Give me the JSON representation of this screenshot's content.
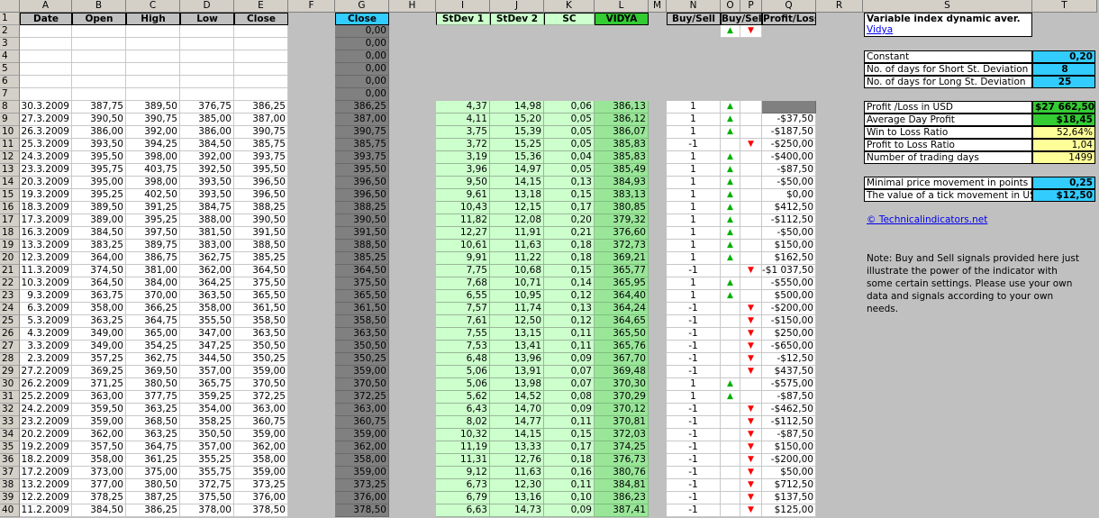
{
  "columns": [
    "A",
    "B",
    "C",
    "D",
    "E",
    "F",
    "G",
    "H",
    "I",
    "J",
    "K",
    "L",
    "M",
    "N",
    "O",
    "P",
    "Q",
    "R",
    "S",
    "T"
  ],
  "headers": {
    "date": "Date",
    "open": "Open",
    "high": "High",
    "low": "Low",
    "close": "Close",
    "close2": "Close",
    "stdev1": "StDev 1",
    "stdev2": "StDev 2",
    "sc": "SC",
    "vidya": "VIDYA",
    "buysell_n": "Buy/Sell",
    "buysell_op": "Buy/Sell",
    "pl": "Profit/Loss",
    "buy_arrow": "▲",
    "sell_arrow": "▼"
  },
  "zero_rows": [
    "0,00",
    "0,00",
    "0,00",
    "0,00",
    "0,00",
    "0,00"
  ],
  "rows": [
    {
      "date": "30.3.2009",
      "open": "387,75",
      "high": "389,50",
      "low": "376,75",
      "close": "386,25",
      "g": "386,25",
      "s1": "4,37",
      "s2": "14,98",
      "sc": "0,06",
      "vidya": "386,13",
      "bs": "1",
      "sig": "up",
      "pl": ""
    },
    {
      "date": "27.3.2009",
      "open": "390,50",
      "high": "390,75",
      "low": "385,00",
      "close": "387,00",
      "g": "387,00",
      "s1": "4,11",
      "s2": "15,20",
      "sc": "0,05",
      "vidya": "386,12",
      "bs": "1",
      "sig": "up",
      "pl": "-$37,50"
    },
    {
      "date": "26.3.2009",
      "open": "386,00",
      "high": "392,00",
      "low": "386,00",
      "close": "390,75",
      "g": "390,75",
      "s1": "3,75",
      "s2": "15,39",
      "sc": "0,05",
      "vidya": "386,07",
      "bs": "1",
      "sig": "up",
      "pl": "-$187,50"
    },
    {
      "date": "25.3.2009",
      "open": "393,50",
      "high": "394,25",
      "low": "384,50",
      "close": "385,75",
      "g": "385,75",
      "s1": "3,72",
      "s2": "15,25",
      "sc": "0,05",
      "vidya": "385,83",
      "bs": "-1",
      "sig": "dn",
      "pl": "-$250,00"
    },
    {
      "date": "24.3.2009",
      "open": "395,50",
      "high": "398,00",
      "low": "392,00",
      "close": "393,75",
      "g": "393,75",
      "s1": "3,19",
      "s2": "15,36",
      "sc": "0,04",
      "vidya": "385,83",
      "bs": "1",
      "sig": "up",
      "pl": "-$400,00"
    },
    {
      "date": "23.3.2009",
      "open": "395,75",
      "high": "403,75",
      "low": "392,50",
      "close": "395,50",
      "g": "395,50",
      "s1": "3,96",
      "s2": "14,97",
      "sc": "0,05",
      "vidya": "385,49",
      "bs": "1",
      "sig": "up",
      "pl": "-$87,50"
    },
    {
      "date": "20.3.2009",
      "open": "395,00",
      "high": "398,00",
      "low": "393,50",
      "close": "396,50",
      "g": "396,50",
      "s1": "9,50",
      "s2": "14,15",
      "sc": "0,13",
      "vidya": "384,93",
      "bs": "1",
      "sig": "up",
      "pl": "-$50,00"
    },
    {
      "date": "19.3.2009",
      "open": "395,25",
      "high": "402,50",
      "low": "393,50",
      "close": "396,50",
      "g": "396,50",
      "s1": "9,61",
      "s2": "13,18",
      "sc": "0,15",
      "vidya": "383,13",
      "bs": "1",
      "sig": "up",
      "pl": "$0,00"
    },
    {
      "date": "18.3.2009",
      "open": "389,50",
      "high": "391,25",
      "low": "384,75",
      "close": "388,25",
      "g": "388,25",
      "s1": "10,43",
      "s2": "12,15",
      "sc": "0,17",
      "vidya": "380,85",
      "bs": "1",
      "sig": "up",
      "pl": "$412,50"
    },
    {
      "date": "17.3.2009",
      "open": "389,00",
      "high": "395,25",
      "low": "388,00",
      "close": "390,50",
      "g": "390,50",
      "s1": "11,82",
      "s2": "12,08",
      "sc": "0,20",
      "vidya": "379,32",
      "bs": "1",
      "sig": "up",
      "pl": "-$112,50"
    },
    {
      "date": "16.3.2009",
      "open": "384,50",
      "high": "397,50",
      "low": "381,50",
      "close": "391,50",
      "g": "391,50",
      "s1": "12,27",
      "s2": "11,91",
      "sc": "0,21",
      "vidya": "376,60",
      "bs": "1",
      "sig": "up",
      "pl": "-$50,00"
    },
    {
      "date": "13.3.2009",
      "open": "383,25",
      "high": "389,75",
      "low": "383,00",
      "close": "388,50",
      "g": "388,50",
      "s1": "10,61",
      "s2": "11,63",
      "sc": "0,18",
      "vidya": "372,73",
      "bs": "1",
      "sig": "up",
      "pl": "$150,00"
    },
    {
      "date": "12.3.2009",
      "open": "364,00",
      "high": "386,75",
      "low": "362,75",
      "close": "385,25",
      "g": "385,25",
      "s1": "9,91",
      "s2": "11,22",
      "sc": "0,18",
      "vidya": "369,21",
      "bs": "1",
      "sig": "up",
      "pl": "$162,50"
    },
    {
      "date": "11.3.2009",
      "open": "374,50",
      "high": "381,00",
      "low": "362,00",
      "close": "364,50",
      "g": "364,50",
      "s1": "7,75",
      "s2": "10,68",
      "sc": "0,15",
      "vidya": "365,77",
      "bs": "-1",
      "sig": "dn",
      "pl": "-$1 037,50"
    },
    {
      "date": "10.3.2009",
      "open": "364,50",
      "high": "384,00",
      "low": "364,25",
      "close": "375,50",
      "g": "375,50",
      "s1": "7,68",
      "s2": "10,71",
      "sc": "0,14",
      "vidya": "365,95",
      "bs": "1",
      "sig": "up",
      "pl": "-$550,00"
    },
    {
      "date": "9.3.2009",
      "open": "363,75",
      "high": "370,00",
      "low": "363,50",
      "close": "365,50",
      "g": "365,50",
      "s1": "6,55",
      "s2": "10,95",
      "sc": "0,12",
      "vidya": "364,40",
      "bs": "1",
      "sig": "up",
      "pl": "$500,00"
    },
    {
      "date": "6.3.2009",
      "open": "358,00",
      "high": "366,25",
      "low": "358,00",
      "close": "361,50",
      "g": "361,50",
      "s1": "7,57",
      "s2": "11,74",
      "sc": "0,13",
      "vidya": "364,24",
      "bs": "-1",
      "sig": "dn",
      "pl": "-$200,00"
    },
    {
      "date": "5.3.2009",
      "open": "363,25",
      "high": "364,75",
      "low": "355,50",
      "close": "358,50",
      "g": "358,50",
      "s1": "7,61",
      "s2": "12,50",
      "sc": "0,12",
      "vidya": "364,65",
      "bs": "-1",
      "sig": "dn",
      "pl": "-$150,00"
    },
    {
      "date": "4.3.2009",
      "open": "349,00",
      "high": "365,00",
      "low": "347,00",
      "close": "363,50",
      "g": "363,50",
      "s1": "7,55",
      "s2": "13,15",
      "sc": "0,11",
      "vidya": "365,50",
      "bs": "-1",
      "sig": "dn",
      "pl": "$250,00"
    },
    {
      "date": "3.3.2009",
      "open": "349,00",
      "high": "354,25",
      "low": "347,25",
      "close": "350,50",
      "g": "350,50",
      "s1": "7,53",
      "s2": "13,41",
      "sc": "0,11",
      "vidya": "365,76",
      "bs": "-1",
      "sig": "dn",
      "pl": "-$650,00"
    },
    {
      "date": "2.3.2009",
      "open": "357,25",
      "high": "362,75",
      "low": "344,50",
      "close": "350,25",
      "g": "350,25",
      "s1": "6,48",
      "s2": "13,96",
      "sc": "0,09",
      "vidya": "367,70",
      "bs": "-1",
      "sig": "dn",
      "pl": "-$12,50"
    },
    {
      "date": "27.2.2009",
      "open": "369,25",
      "high": "369,50",
      "low": "357,00",
      "close": "359,00",
      "g": "359,00",
      "s1": "5,06",
      "s2": "13,91",
      "sc": "0,07",
      "vidya": "369,48",
      "bs": "-1",
      "sig": "dn",
      "pl": "$437,50"
    },
    {
      "date": "26.2.2009",
      "open": "371,25",
      "high": "380,50",
      "low": "365,75",
      "close": "370,50",
      "g": "370,50",
      "s1": "5,06",
      "s2": "13,98",
      "sc": "0,07",
      "vidya": "370,30",
      "bs": "1",
      "sig": "up",
      "pl": "-$575,00"
    },
    {
      "date": "25.2.2009",
      "open": "363,00",
      "high": "377,75",
      "low": "359,25",
      "close": "372,25",
      "g": "372,25",
      "s1": "5,62",
      "s2": "14,52",
      "sc": "0,08",
      "vidya": "370,29",
      "bs": "1",
      "sig": "up",
      "pl": "-$87,50"
    },
    {
      "date": "24.2.2009",
      "open": "359,50",
      "high": "363,25",
      "low": "354,00",
      "close": "363,00",
      "g": "363,00",
      "s1": "6,43",
      "s2": "14,70",
      "sc": "0,09",
      "vidya": "370,12",
      "bs": "-1",
      "sig": "dn",
      "pl": "-$462,50"
    },
    {
      "date": "23.2.2009",
      "open": "359,00",
      "high": "368,50",
      "low": "358,25",
      "close": "360,75",
      "g": "360,75",
      "s1": "8,02",
      "s2": "14,77",
      "sc": "0,11",
      "vidya": "370,81",
      "bs": "-1",
      "sig": "dn",
      "pl": "-$112,50"
    },
    {
      "date": "20.2.2009",
      "open": "362,00",
      "high": "363,25",
      "low": "350,50",
      "close": "359,00",
      "g": "359,00",
      "s1": "10,32",
      "s2": "14,15",
      "sc": "0,15",
      "vidya": "372,03",
      "bs": "-1",
      "sig": "dn",
      "pl": "-$87,50"
    },
    {
      "date": "19.2.2009",
      "open": "357,50",
      "high": "364,75",
      "low": "357,00",
      "close": "362,00",
      "g": "362,00",
      "s1": "11,19",
      "s2": "13,33",
      "sc": "0,17",
      "vidya": "374,25",
      "bs": "-1",
      "sig": "dn",
      "pl": "$150,00"
    },
    {
      "date": "18.2.2009",
      "open": "358,00",
      "high": "361,25",
      "low": "355,25",
      "close": "358,00",
      "g": "358,00",
      "s1": "11,31",
      "s2": "12,76",
      "sc": "0,18",
      "vidya": "376,73",
      "bs": "-1",
      "sig": "dn",
      "pl": "-$200,00"
    },
    {
      "date": "17.2.2009",
      "open": "373,00",
      "high": "375,00",
      "low": "355,75",
      "close": "359,00",
      "g": "359,00",
      "s1": "9,12",
      "s2": "11,63",
      "sc": "0,16",
      "vidya": "380,76",
      "bs": "-1",
      "sig": "dn",
      "pl": "$50,00"
    },
    {
      "date": "13.2.2009",
      "open": "377,00",
      "high": "380,50",
      "low": "372,75",
      "close": "373,25",
      "g": "373,25",
      "s1": "6,73",
      "s2": "12,30",
      "sc": "0,11",
      "vidya": "384,81",
      "bs": "-1",
      "sig": "dn",
      "pl": "$712,50"
    },
    {
      "date": "12.2.2009",
      "open": "378,25",
      "high": "387,25",
      "low": "375,50",
      "close": "376,00",
      "g": "376,00",
      "s1": "6,79",
      "s2": "13,16",
      "sc": "0,10",
      "vidya": "386,23",
      "bs": "-1",
      "sig": "dn",
      "pl": "$137,50"
    },
    {
      "date": "11.2.2009",
      "open": "384,50",
      "high": "386,25",
      "low": "378,00",
      "close": "378,50",
      "g": "378,50",
      "s1": "6,63",
      "s2": "14,73",
      "sc": "0,09",
      "vidya": "387,41",
      "bs": "-1",
      "sig": "dn",
      "pl": "$125,00"
    }
  ],
  "side": {
    "title": "Variable index dynamic aver.",
    "subtitle": "Vidya",
    "constant_label": "Constant",
    "constant_value": "0,20",
    "short_label": "No. of days for Short St. Deviation",
    "short_value": "8",
    "long_label": "No. of days for Long St. Deviation",
    "long_value": "25",
    "profit_label": "Profit /Loss in USD",
    "profit_value": "$27 662,50",
    "avg_label": "Average Day Profit",
    "avg_value": "$18,45",
    "win_label": "Win to Loss Ratio",
    "win_value": "52,64%",
    "ptl_label": "Profit to Loss Ratio",
    "ptl_value": "1,04",
    "days_label": "Number of trading days",
    "days_value": "1499",
    "minprice_label": "Minimal price movement in points",
    "minprice_value": "0,25",
    "tick_label": "The value of a tick movement in USD",
    "tick_value": "$12,50",
    "link": "© Technicalindicators.net",
    "note": "Note: Buy and Sell signals provided here just illustrate the power of the indicator with some certain settings. Please use your own data and signals according to your own needs."
  },
  "colors": {
    "cyan": "#33ccff",
    "green": "#33cc33",
    "light_green": "#ccffcc",
    "yellow": "#ffff99",
    "up": "#00b000",
    "down": "#ff0000"
  }
}
